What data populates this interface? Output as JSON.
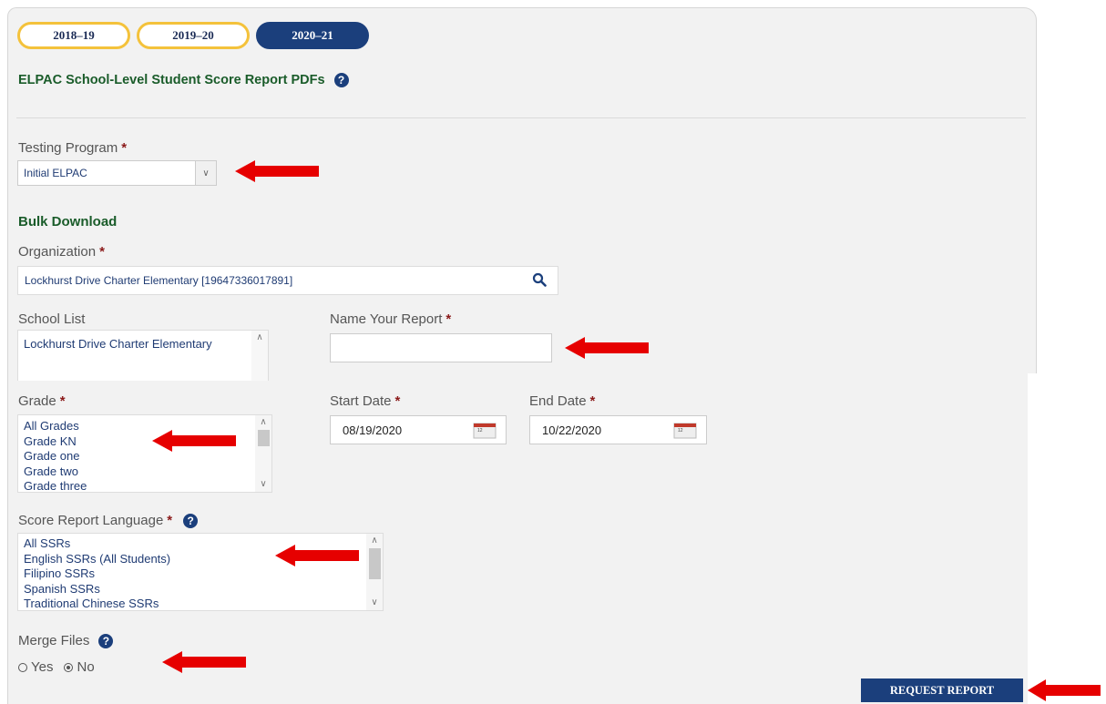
{
  "tabs": [
    {
      "label": "2018–19",
      "active": false
    },
    {
      "label": "2019–20",
      "active": false
    },
    {
      "label": "2020–21",
      "active": true
    }
  ],
  "page_title": "ELPAC School-Level Student Score Report PDFs",
  "testing_program": {
    "label": "Testing Program",
    "required_mark": "*",
    "value": "Initial ELPAC"
  },
  "bulk_download_heading": "Bulk Download",
  "organization": {
    "label": "Organization",
    "required_mark": "*",
    "value": "Lockhurst Drive Charter Elementary [19647336017891]",
    "icon": "search-icon"
  },
  "school_list": {
    "label": "School List",
    "items": [
      "Lockhurst Drive Charter Elementary"
    ]
  },
  "report_name": {
    "label": "Name Your Report",
    "required_mark": "*",
    "value": ""
  },
  "grade": {
    "label": "Grade",
    "required_mark": "*",
    "items": [
      "All Grades",
      "Grade KN",
      "Grade one",
      "Grade two",
      "Grade three"
    ]
  },
  "start_date": {
    "label": "Start Date",
    "required_mark": "*",
    "value": "08/19/2020",
    "icon": "calendar-icon"
  },
  "end_date": {
    "label": "End Date",
    "required_mark": "*",
    "value": "10/22/2020",
    "icon": "calendar-icon"
  },
  "score_report_language": {
    "label": "Score Report Language",
    "required_mark": "*",
    "items": [
      "All SSRs",
      "English SSRs (All Students)",
      "Filipino SSRs",
      "Spanish SSRs",
      "Traditional Chinese SSRs"
    ]
  },
  "merge_files": {
    "label": "Merge Files",
    "options": [
      {
        "label": "Yes",
        "selected": false
      },
      {
        "label": "No",
        "selected": true
      }
    ]
  },
  "request_button": "REQUEST REPORT",
  "colors": {
    "accent_navy": "#1b3f7c",
    "heading_green": "#1a5c2a",
    "tab_border_gold": "#f4c23b",
    "annotation_red": "#e60000",
    "required_red": "#8b1a1a"
  }
}
